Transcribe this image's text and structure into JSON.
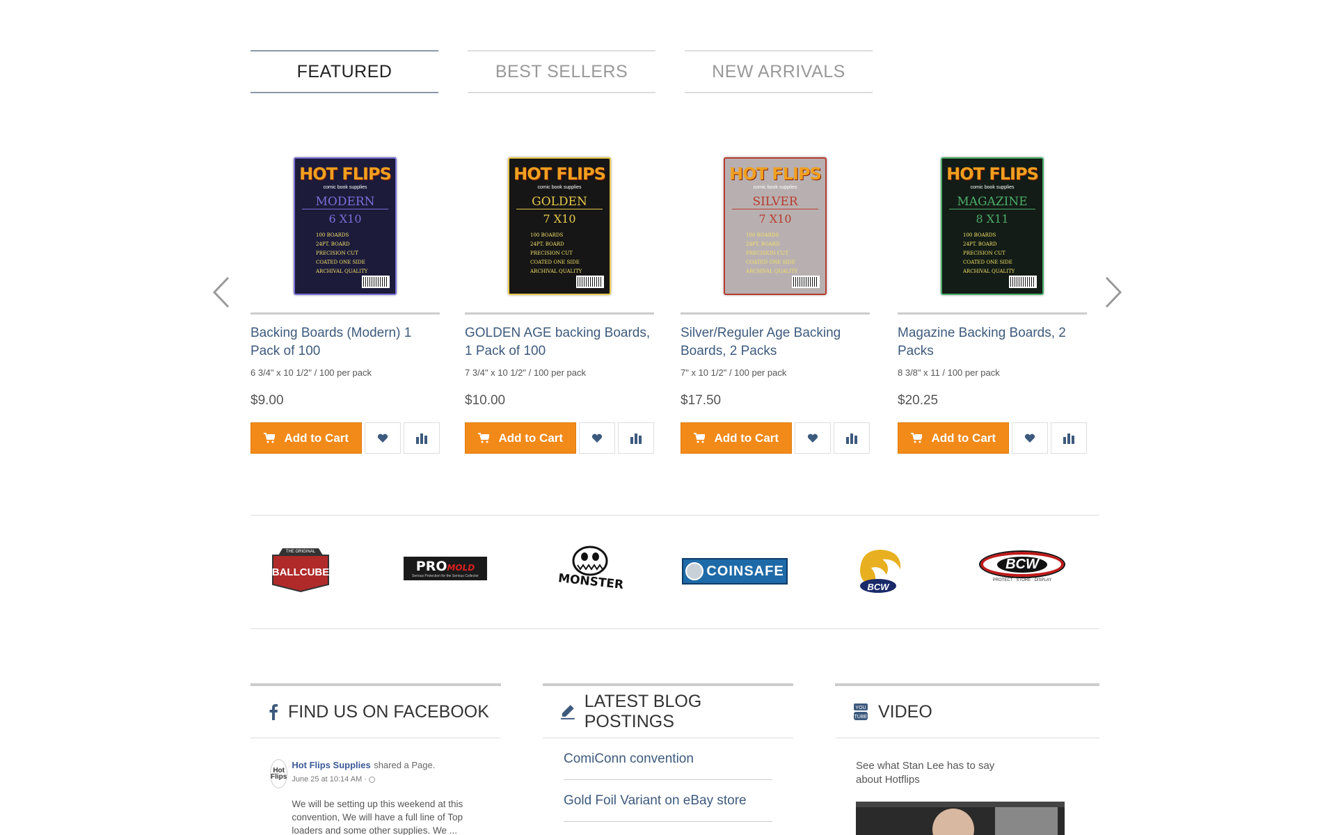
{
  "tabs": [
    {
      "label": "FEATURED"
    },
    {
      "label": "BEST SELLERS"
    },
    {
      "label": "NEW ARRIVALS"
    }
  ],
  "products": [
    {
      "name": "Backing Boards (Modern) 1 Pack of 100",
      "spec": "6 3/4\" x 10 1/2\" / 100 per pack",
      "price": "$9.00",
      "cart_label": "Add to Cart",
      "pack": {
        "kind": "MODERN",
        "size": "6 X10",
        "bg": "#1c1b3a",
        "accent": "#7a6fd8"
      }
    },
    {
      "name": "GOLDEN AGE backing Boards, 1 Pack of 100",
      "spec": "7 3/4\" x 10 1/2\" / 100 per pack",
      "price": "$10.00",
      "cart_label": "Add to Cart",
      "pack": {
        "kind": "GOLDEN",
        "size": "7 X10",
        "bg": "#161616",
        "accent": "#e8c94a"
      }
    },
    {
      "name": "Silver/Reguler Age Backing Boards, 2 Packs",
      "spec": "7\" x 10 1/2\" / 100 per pack",
      "price": "$17.50",
      "cart_label": "Add to Cart",
      "pack": {
        "kind": "SILVER",
        "size": "7 X10",
        "bg": "#b8b0b0",
        "accent": "#b83a2e"
      }
    },
    {
      "name": "Magazine Backing Boards, 2 Packs",
      "spec": "8 3/8\" x 11 / 100 per pack",
      "price": "$20.25",
      "cart_label": "Add to Cart",
      "pack": {
        "kind": "MAGAZINE",
        "size": "8 X11",
        "bg": "#131c16",
        "accent": "#4cae6a"
      }
    }
  ],
  "pack_common": {
    "logo": "HOT FLIPS",
    "sub": "comic book supplies",
    "lines": [
      "100 BOARDS",
      "24PT. BOARD",
      "PRECISION CUT",
      "COATED ONE SIDE",
      "ARCHIVAL QUALITY"
    ]
  },
  "brands": [
    {
      "name": "BALLCUBE",
      "top": "THE ORIGINAL",
      "color": "#b02a2a"
    },
    {
      "name": "PRO",
      "suffix": "MOLD",
      "tagline": "Serious Protection for the Serious Collector"
    },
    {
      "name": "MONSTER"
    },
    {
      "name": "COINSAFE",
      "color": "#1e6aa8"
    },
    {
      "name": "BCW",
      "color": "#e8b020"
    },
    {
      "name": "BCW",
      "tagline": "PROTECT · STORE · DISPLAY",
      "color": "#c01a1a"
    }
  ],
  "facebook": {
    "heading": "FIND US ON FACEBOOK",
    "page_name": "Hot Flips Supplies",
    "action": "shared a Page.",
    "time": "June 25 at 10:14 AM ·",
    "avatar_text": "Hot Flips",
    "text": "We will be setting up this weekend at this convention, We will have a full line of Top loaders and some other supplies. We ..."
  },
  "blog": {
    "heading": "LATEST BLOG POSTINGS",
    "posts": [
      "ComiConn convention",
      "Gold Foil Variant on eBay store"
    ]
  },
  "video": {
    "heading": "VIDEO",
    "text": "See what Stan Lee has to say about Hotflips"
  },
  "colors": {
    "accent": "#f28a1a",
    "link": "#3d5a7d",
    "icon": "#3d5a7d"
  }
}
